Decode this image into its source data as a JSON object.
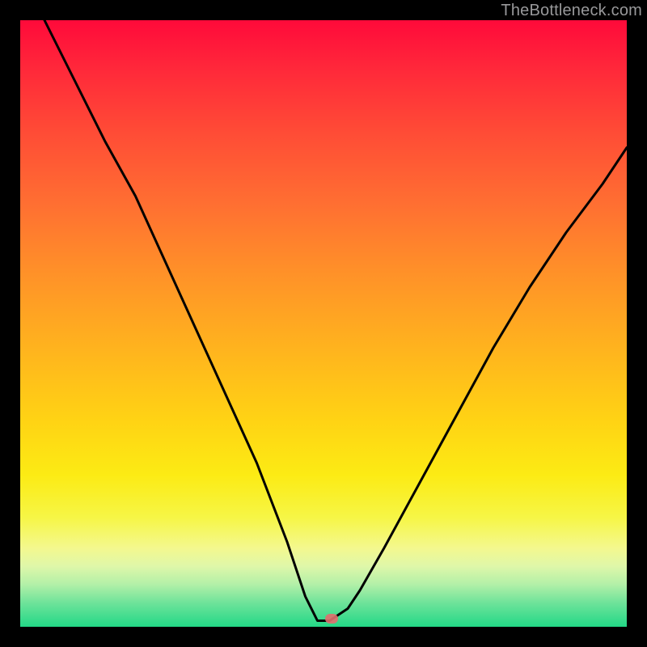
{
  "watermark": "TheBottleneck.com",
  "chart_data": {
    "type": "line",
    "title": "",
    "xlabel": "",
    "ylabel": "",
    "xlim": [
      0,
      100
    ],
    "ylim": [
      0,
      100
    ],
    "background_gradient": {
      "orientation": "vertical",
      "stops": [
        {
          "pos": 0,
          "color": "#ff0a3a"
        },
        {
          "pos": 18,
          "color": "#ff4a36"
        },
        {
          "pos": 42,
          "color": "#ff9228"
        },
        {
          "pos": 66,
          "color": "#ffd314"
        },
        {
          "pos": 82,
          "color": "#f6f646"
        },
        {
          "pos": 93,
          "color": "#b3f0a8"
        },
        {
          "pos": 100,
          "color": "#23d887"
        }
      ]
    },
    "series": [
      {
        "name": "curve",
        "color": "#000000",
        "x": [
          4,
          9,
          14,
          19,
          24,
          29,
          34,
          39,
          44,
          47,
          49,
          51,
          54,
          56,
          60,
          66,
          72,
          78,
          84,
          90,
          96,
          100
        ],
        "y": [
          100,
          90,
          80,
          71,
          60,
          49,
          38,
          27,
          14,
          5,
          1,
          1,
          3,
          6,
          13,
          24,
          35,
          46,
          56,
          65,
          73,
          79
        ]
      }
    ],
    "marker": {
      "x": 51,
      "y": 0,
      "shape": "rounded-rect",
      "color": "#e26e6e"
    }
  }
}
